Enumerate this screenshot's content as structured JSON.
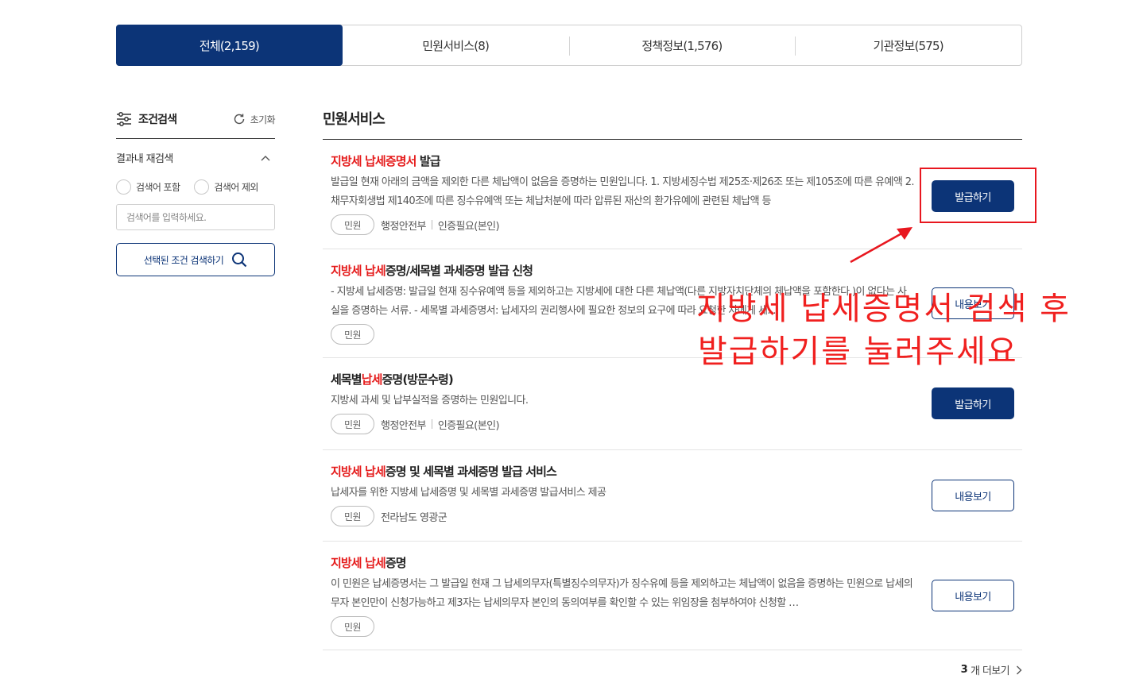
{
  "tabs": [
    {
      "label": "전체(2,159)",
      "active": true
    },
    {
      "label": "민원서비스(8)",
      "active": false
    },
    {
      "label": "정책정보(1,576)",
      "active": false
    },
    {
      "label": "기관정보(575)",
      "active": false
    }
  ],
  "sidebar": {
    "title": "조건검색",
    "reset_label": "초기화",
    "refine_label": "결과내 재검색",
    "radio_include": "검색어 포함",
    "radio_exclude": "검색어 제외",
    "search_placeholder": "검색어를 입력하세요.",
    "search_button": "선택된 조건 검색하기"
  },
  "section": {
    "title": "민원서비스"
  },
  "items": [
    {
      "title_hl1": "지방세 납세증명서",
      "title_rest1": " 발급",
      "desc": "발급일 현재 아래의 금액을 제외한 다른 체납액이 없음을 증명하는 민원입니다. 1. 지방세징수법 제25조·제26조 또는 제105조에 따른 유예액 2. 채무자회생법 제140조에 따른 징수유예액 또는 체납처분에 따라 압류된 재산의 환가유예에 관련된 체납액 등",
      "tag": "민원",
      "agency": "행정안전부",
      "auth": "인증필요(본인)",
      "button": "발급하기"
    },
    {
      "title_hl1": "지방세 납세",
      "title_rest1": "증명/세목별 과세증명 발급 신청",
      "desc": "- 지방세 납세증명: 발급일 현재 징수유예액 등을 제외하고는 지방세에 대한 다른 체납액(다른 지방자치단체의 체납액을 포함한다.)이 없다는 사실을 증명하는 서류. - 세목별 과세증명서: 납세자의 권리행사에 필요한 정보의 요구에 따라 요청한 자에게 세...",
      "tag": "민원",
      "button": "내용보기"
    },
    {
      "title_pre": "세목별",
      "title_hl1": "납세",
      "title_rest1": "증명(방문수령)",
      "desc": "지방세 과세 및 납부실적을 증명하는 민원입니다.",
      "tag": "민원",
      "agency": "행정안전부",
      "auth": "인증필요(본인)",
      "button": "발급하기"
    },
    {
      "title_hl1": "지방세 납세",
      "title_rest1": "증명 및 세목별 과세증명 발급 서비스",
      "desc": "납세자를 위한 지방세 납세증명 및 세목별 과세증명 발급서비스 제공",
      "tag": "민원",
      "agency": "전라남도 영광군",
      "button": "내용보기"
    },
    {
      "title_hl1": "지방세 납세",
      "title_rest1": "증명",
      "desc": "이 민원은 납세증명서는 그 발급일 현재 그 납세의무자(특별징수의무자)가 징수유예 등을 제외하고는 체납액이 없음을 증명하는 민원으로 납세의무자 본인만이 신청가능하고 제3자는 납세의무자 본인의 동의여부를 확인할 수 있는 위임장을 첨부하여야 신청할 …",
      "tag": "민원",
      "button": "내용보기"
    }
  ],
  "more": {
    "count": "3",
    "label": "개 더보기"
  },
  "annotation": {
    "line1": "지방세 납세증명서 검색 후",
    "line2": "발급하기를 눌러주세요"
  },
  "colors": {
    "primary": "#0c3477",
    "highlight": "#e51b1b",
    "annotation": "#f0201f"
  }
}
